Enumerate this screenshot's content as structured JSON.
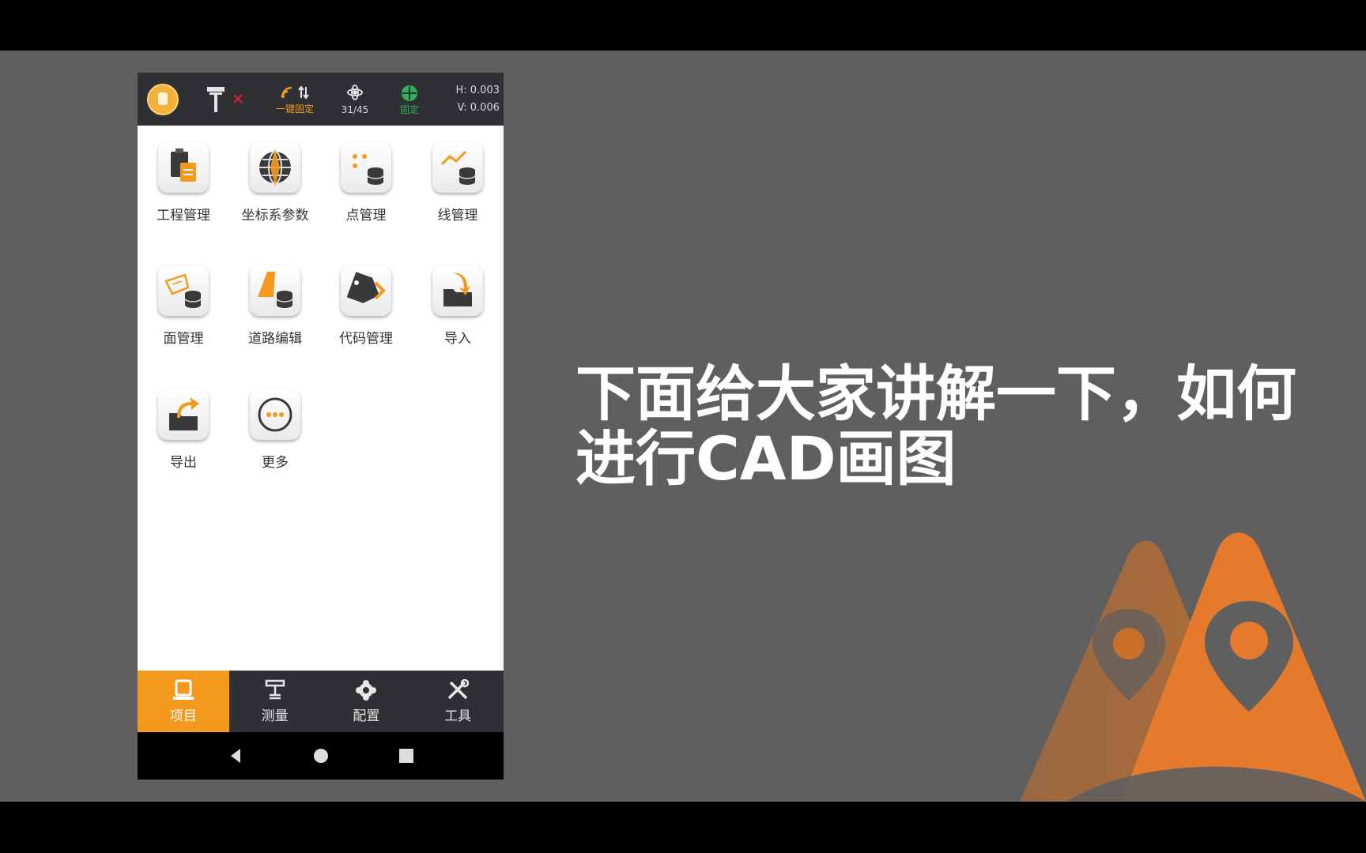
{
  "status_bar": {
    "signal_label": "一键固定",
    "satellites": "31/45",
    "fix_label": "固定",
    "h_precision": "H: 0.003",
    "v_precision": "V: 0.006"
  },
  "apps": [
    {
      "label": "工程管理",
      "icon": "project-management-icon"
    },
    {
      "label": "坐标系参数",
      "icon": "coordinate-system-icon"
    },
    {
      "label": "点管理",
      "icon": "point-management-icon"
    },
    {
      "label": "线管理",
      "icon": "line-management-icon"
    },
    {
      "label": "面管理",
      "icon": "area-management-icon"
    },
    {
      "label": "道路编辑",
      "icon": "road-edit-icon"
    },
    {
      "label": "代码管理",
      "icon": "code-management-icon"
    },
    {
      "label": "导入",
      "icon": "import-icon"
    },
    {
      "label": "导出",
      "icon": "export-icon"
    },
    {
      "label": "更多",
      "icon": "more-icon"
    }
  ],
  "tabs": [
    {
      "label": "项目",
      "active": true
    },
    {
      "label": "测量",
      "active": false
    },
    {
      "label": "配置",
      "active": false
    },
    {
      "label": "工具",
      "active": false
    }
  ],
  "caption": {
    "line1": "下面给大家讲解一下，如何",
    "line2": "进行CAD画图"
  },
  "colors": {
    "accent": "#f39a1e",
    "dark_bar": "#2f3033",
    "background": "#5f5f60"
  }
}
